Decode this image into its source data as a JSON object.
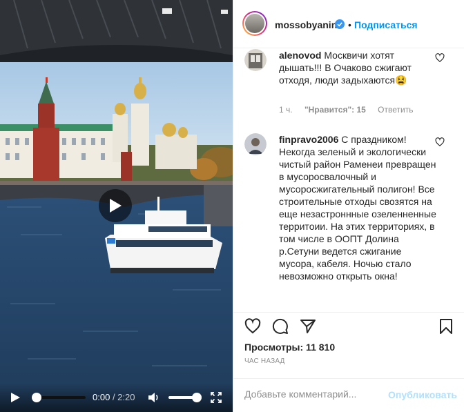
{
  "media": {
    "current_time": "0:00",
    "duration": "/ 2:20",
    "seek_progress": 0,
    "volume_level": 1
  },
  "header": {
    "username": "mossobyanin",
    "separator": "•",
    "follow_label": "Подписаться"
  },
  "comments": [
    {
      "username": "alenovod",
      "text": "Москвичи хотят дышать!!! В Очаково сжигают отходя, люди задыхаются😫",
      "time": "1 ч.",
      "likes": "\"Нравится\": 15",
      "reply_label": "Ответить"
    },
    {
      "username": "finpravo2006",
      "text": "С праздником! Некогда зеленый и экологически чистый район Раменеи превращен в мусоросвалочный и мусоросжигательный полигон! Все строительные отходы свозятся на еще незастроннные озеленненные территоии. На этих территориях, в том числе в ООПТ Долина р.Сетуни ведется сжигание мусора, кабеля. Ночью стало невозможно открыть окна!"
    }
  ],
  "stats": {
    "views": "Просмотры: 11 810",
    "time_ago": "ЧАС НАЗАД"
  },
  "add_comment": {
    "placeholder": "Добавьте комментарий...",
    "publish_label": "Опубликовать"
  },
  "colors": {
    "accent": "#0095f6",
    "publish_disabled": "#b2dffc",
    "muted": "#8e8e8e",
    "border": "#efefef"
  },
  "icons": [
    "play-icon",
    "volume-icon",
    "fullscreen-icon",
    "verified-icon",
    "heart-icon",
    "comment-icon",
    "share-icon",
    "bookmark-icon"
  ]
}
